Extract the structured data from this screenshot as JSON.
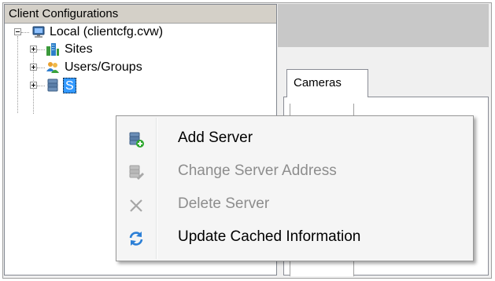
{
  "tree": {
    "header": "Client Configurations",
    "root": {
      "label": "Local (clientcfg.cvw)"
    },
    "children": [
      {
        "label": "Sites",
        "icon": "sites-icon"
      },
      {
        "label": "Users/Groups",
        "icon": "users-groups-icon"
      },
      {
        "label": "S",
        "icon": "servers-icon",
        "selected": true
      }
    ]
  },
  "tabs": [
    {
      "label": "Cameras"
    }
  ],
  "context_menu": {
    "items": [
      {
        "label": "Add Server",
        "icon": "add-server-icon",
        "enabled": true
      },
      {
        "label": "Change Server Address",
        "icon": "change-server-icon",
        "enabled": false
      },
      {
        "label": "Delete Server",
        "icon": "delete-x-icon",
        "enabled": false
      },
      {
        "label": "Update Cached Information",
        "icon": "refresh-icon",
        "enabled": true
      }
    ]
  },
  "colors": {
    "selection": "#3399ff",
    "disabled_text": "#8d8d8d",
    "menu_bg": "#f5f5f5"
  }
}
